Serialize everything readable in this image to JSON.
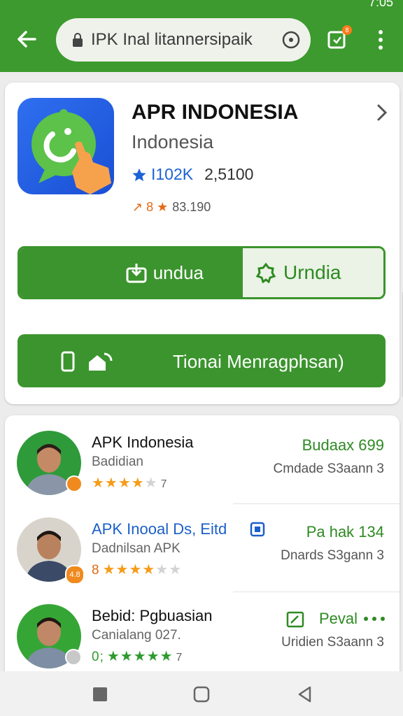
{
  "status": {
    "time": "7:05"
  },
  "header": {
    "url_text": "IPK Inal litannersipaik",
    "tabs_badge": "8"
  },
  "app": {
    "title": "APR INDONESIA",
    "subtitle": "Indonesia",
    "rating_label": "I102K",
    "downloads": "2,5100",
    "meta_prefix": "↗ 8 ★",
    "meta_value": "83.190",
    "download_label": "undua",
    "install_label": "Urndia",
    "manage_label": "Tionai Menragphsan)"
  },
  "list": [
    {
      "name": "APK Indonesia",
      "sub": "Badidian",
      "prefix": "",
      "stars_filled": 4,
      "stars_total": 5,
      "count": "7",
      "price": "Budaax 699",
      "meta": "Cmdade S3aann 3",
      "avatar_badge": "",
      "name_blue": false,
      "green_bg": true
    },
    {
      "name": "APK Inooal Ds, Eitd",
      "sub": "Dadnilsan APK",
      "prefix": "8",
      "stars_filled": 4,
      "stars_total": 5,
      "count": "",
      "price": "Pa hak 134",
      "meta": "Dnards S3gann 3",
      "avatar_badge": "4.8",
      "name_blue": true,
      "green_bg": false
    },
    {
      "name": "Bebid: Pgbuasian",
      "sub": "Canialang 027.",
      "prefix": "0;",
      "stars_filled": 5,
      "stars_total": 5,
      "count": "7",
      "price": "Peval",
      "meta": "Uridien S3aann 3",
      "avatar_badge": "",
      "name_blue": false,
      "green_bg": true
    }
  ],
  "colors": {
    "primary": "#3c9a2e",
    "accent_orange": "#f08a1e",
    "link_blue": "#1c63d4"
  }
}
